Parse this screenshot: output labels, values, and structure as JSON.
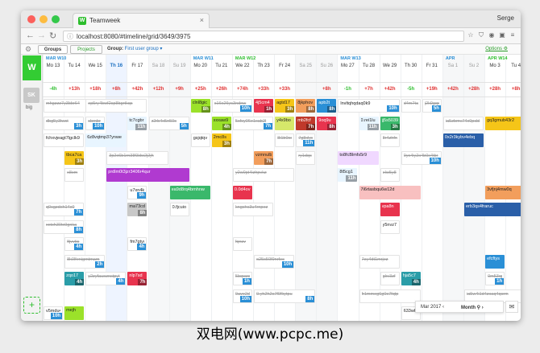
{
  "browser": {
    "tab_title": "Teamweek",
    "tab_close": "×",
    "user": "Serge",
    "url": "localhost:8080/#timeline/grid/3649/3975",
    "back": "←",
    "forward": "→",
    "reload": "↻",
    "star": "☆"
  },
  "toolbar": {
    "groups_tab": "Groups",
    "projects_tab": "Projects",
    "group_label": "Group:",
    "group_value": "First user group ▾",
    "options": "Options ⚙"
  },
  "sidebar": {
    "logo": "W",
    "avatar_initials": "SK",
    "avatar_name": "big",
    "add_user": "+"
  },
  "months": [
    {
      "label": "MAR W10",
      "green": false
    },
    {
      "label": "MAR W11",
      "green": false
    },
    {
      "label": "MAR W12",
      "green": true
    },
    {
      "label": "MAR W13",
      "green": false
    },
    {
      "label": "APR",
      "green": false
    },
    {
      "label": "APR W14",
      "green": true
    }
  ],
  "days": [
    {
      "label": "Mo 13",
      "weekend": false,
      "today": false
    },
    {
      "label": "Tu 14",
      "weekend": false,
      "today": false
    },
    {
      "label": "We 15",
      "weekend": false,
      "today": false
    },
    {
      "label": "Th 16",
      "weekend": false,
      "today": true
    },
    {
      "label": "Fr 17",
      "weekend": false,
      "today": false
    },
    {
      "label": "Sa 18",
      "weekend": true,
      "today": false
    },
    {
      "label": "Su 19",
      "weekend": true,
      "today": false
    },
    {
      "label": "Mo 20",
      "weekend": false,
      "today": false
    },
    {
      "label": "Tu 21",
      "weekend": false,
      "today": false
    },
    {
      "label": "We 22",
      "weekend": false,
      "today": false
    },
    {
      "label": "Th 23",
      "weekend": false,
      "today": false
    },
    {
      "label": "Fr 24",
      "weekend": false,
      "today": false
    },
    {
      "label": "Sa 25",
      "weekend": true,
      "today": false
    },
    {
      "label": "Su 26",
      "weekend": true,
      "today": false
    },
    {
      "label": "Mo 27",
      "weekend": false,
      "today": false
    },
    {
      "label": "Tu 28",
      "weekend": false,
      "today": false
    },
    {
      "label": "We 29",
      "weekend": false,
      "today": false
    },
    {
      "label": "Th 30",
      "weekend": false,
      "today": false
    },
    {
      "label": "Fr 31",
      "weekend": false,
      "today": false
    },
    {
      "label": "Sa 1",
      "weekend": true,
      "today": false
    },
    {
      "label": "Su 2",
      "weekend": true,
      "today": false
    },
    {
      "label": "Mo 3",
      "weekend": false,
      "today": false
    },
    {
      "label": "Tu 4",
      "weekend": false,
      "today": false
    }
  ],
  "hour_diffs": [
    "-4h",
    "+13h",
    "+18h",
    "+8h",
    "+42h",
    "+12h",
    "+9h",
    "+25h",
    "+26h",
    "+74h",
    "+33h",
    "+33h",
    "",
    "+8h",
    "-1h",
    "+7h",
    "+42h",
    "-5h",
    "+19h",
    "+42h",
    "+28h",
    "+28h",
    "+8h"
  ],
  "colors": {
    "positive": "#e03030",
    "negative": "#2dbe2d",
    "brand": "#33cc33",
    "link": "#1a6fc0"
  },
  "tasks": [
    {
      "label": "mhgzzz7y3bbr64",
      "hours": "",
      "color": "#ffffff",
      "done": true,
      "d": 0,
      "w": 2.6,
      "r": 0
    },
    {
      "label": "ep5ry4bwf2sp8bgrtkqs",
      "hours": "",
      "color": "#ffffff",
      "done": true,
      "d": 2,
      "w": 3,
      "r": 0
    },
    {
      "label": "clnl8gic",
      "hours": "8h",
      "color": "#9be12a",
      "done": false,
      "d": 7,
      "w": 1,
      "r": 0
    },
    {
      "label": "s16x26ys3ndnw",
      "hours": "10h",
      "color": "#ffffff",
      "done": true,
      "d": 8,
      "w": 2,
      "r": 0
    },
    {
      "label": "4j5cm4",
      "hours": "1h",
      "color": "#e8344e",
      "done": false,
      "d": 10,
      "w": 1,
      "r": 0
    },
    {
      "label": "agtd17",
      "hours": "3h",
      "color": "#f5c518",
      "done": false,
      "d": 11,
      "w": 1,
      "r": 0
    },
    {
      "label": "8jkphov",
      "hours": "8h",
      "color": "#f29e5c",
      "done": false,
      "d": 12,
      "w": 1,
      "r": 0
    },
    {
      "label": "apb2t",
      "hours": "8h",
      "color": "#2a8fd6",
      "done": false,
      "d": 13,
      "w": 1,
      "r": 0
    },
    {
      "label": "lnvltqhqdaq0k9",
      "hours": "10h",
      "color": "#ffffff",
      "done": false,
      "d": 14,
      "w": 3,
      "r": 0
    },
    {
      "label": "d4m7ta",
      "hours": "",
      "color": "#ffffff",
      "done": true,
      "d": 17,
      "w": 1,
      "r": 0
    },
    {
      "label": "j2k9gqs6",
      "hours": "5h",
      "color": "#ffffff",
      "done": true,
      "d": 18,
      "w": 1,
      "r": 0
    },
    {
      "label": "dbg5y3twst",
      "hours": "3h",
      "color": "#ffffff",
      "done": true,
      "d": 0,
      "w": 2,
      "r": 1
    },
    {
      "label": "sbrnbr",
      "hours": "10h",
      "color": "#ffffff",
      "done": true,
      "d": 2,
      "w": 1,
      "r": 1
    },
    {
      "label": "tc7cgbr",
      "hours": "11h",
      "color": "#e8f5ff",
      "done": false,
      "d": 4,
      "w": 1,
      "r": 1
    },
    {
      "label": "z2rb4x5n50s",
      "hours": "5h",
      "color": "#ffffff",
      "done": true,
      "d": 5,
      "w": 2,
      "r": 1
    },
    {
      "label": "xxxaw9",
      "hours": "4h",
      "color": "#9be12a",
      "done": false,
      "d": 8,
      "w": 1,
      "r": 1
    },
    {
      "label": "5sfsy06e1xab2l",
      "hours": "7h",
      "color": "#ffffff",
      "done": true,
      "d": 9,
      "w": 2,
      "r": 1
    },
    {
      "label": "y4x9bo",
      "hours": "",
      "color": "#d6e86a",
      "done": false,
      "d": 11,
      "w": 1,
      "r": 1
    },
    {
      "label": "mb2fcf",
      "hours": "7h",
      "color": "#c0392b",
      "done": false,
      "d": 12,
      "w": 1,
      "r": 1
    },
    {
      "label": "9oq9u",
      "hours": "8h",
      "color": "#e8344e",
      "done": false,
      "d": 13,
      "w": 1,
      "r": 1
    },
    {
      "label": "0.rei1lu",
      "hours": "11h",
      "color": "#e8f5ff",
      "done": false,
      "d": 15,
      "w": 1,
      "r": 1
    },
    {
      "label": "jj5s5039",
      "hours": "3h",
      "color": "#3ab86b",
      "done": false,
      "d": 16,
      "w": 1,
      "r": 1
    },
    {
      "label": "ia5zbmv74x0pcbl",
      "hours": "",
      "color": "#ffffff",
      "done": true,
      "d": 19,
      "w": 2,
      "r": 1
    },
    {
      "label": "gq3gmub43r2",
      "hours": "",
      "color": "#f5c518",
      "done": false,
      "d": 21,
      "w": 2,
      "r": 1
    },
    {
      "label": "fchxvjeagt7lgclk9",
      "hours": "",
      "color": "#ffffff",
      "done": false,
      "d": 0,
      "w": 2,
      "r": 2
    },
    {
      "label": "6z8vqtmp37ynwe",
      "hours": "",
      "color": "#e8f5ff",
      "done": false,
      "d": 2,
      "w": 2,
      "r": 2
    },
    {
      "label": "gsjqtqv",
      "hours": "",
      "color": "#ffffff",
      "done": false,
      "d": 7,
      "w": 1,
      "r": 2
    },
    {
      "label": "2mc8s",
      "hours": "3h",
      "color": "#f5c518",
      "done": false,
      "d": 8,
      "w": 1,
      "r": 2
    },
    {
      "label": "8i1b0sdg",
      "hours": "",
      "color": "#ffffff",
      "done": true,
      "d": 11,
      "w": 1,
      "r": 2
    },
    {
      "label": "7g8xlys",
      "hours": "11h",
      "color": "#ffffff",
      "done": true,
      "d": 12,
      "w": 1,
      "r": 2
    },
    {
      "label": "8r4zhfnm",
      "hours": "",
      "color": "#ffffff",
      "done": true,
      "d": 16,
      "w": 1,
      "r": 2
    },
    {
      "label": "0x2r3kybv4ebq",
      "hours": "",
      "color": "#2a5fa8",
      "done": false,
      "d": 19,
      "w": 2,
      "r": 2
    },
    {
      "label": "tbca7ca",
      "hours": "3h",
      "color": "#f5c518",
      "done": false,
      "d": 1,
      "w": 1,
      "r": 3
    },
    {
      "label": "3p2x6b1rn38f3dw2j2jh",
      "hours": "",
      "color": "#ffffff",
      "done": true,
      "d": 3,
      "w": 3,
      "r": 3
    },
    {
      "label": "vzmnulb",
      "hours": "7h",
      "color": "#f29e5c",
      "done": false,
      "d": 10,
      "w": 1,
      "r": 3
    },
    {
      "label": "ry1dqc",
      "hours": "",
      "color": "#ffffff",
      "done": true,
      "d": 12,
      "w": 1,
      "r": 3
    },
    {
      "label": "to8fcBlmfs5r9",
      "hours": "",
      "color": "#f0d8ff",
      "done": false,
      "d": 14,
      "w": 2,
      "r": 3
    },
    {
      "label": "0yx4iy2x4b0x4tbr",
      "hours": "10h",
      "color": "#ffffff",
      "done": true,
      "d": 17,
      "w": 2,
      "r": 3
    },
    {
      "label": "x8cm",
      "hours": "",
      "color": "#ffffff",
      "done": true,
      "d": 1,
      "w": 1,
      "r": 4
    },
    {
      "label": "prdlm0t3jzr3406r4qur",
      "hours": "",
      "color": "#b03ad0",
      "done": false,
      "d": 3,
      "w": 4,
      "r": 4
    },
    {
      "label": "y2w0pt4izhpvkz",
      "hours": "",
      "color": "#ffffff",
      "done": true,
      "d": 9,
      "w": 3,
      "r": 4
    },
    {
      "label": "8t5cg1",
      "hours": "11h",
      "color": "#e8f5ff",
      "done": false,
      "d": 14,
      "w": 1,
      "r": 4
    },
    {
      "label": "elw5y8",
      "hours": "",
      "color": "#ffffff",
      "done": true,
      "d": 16,
      "w": 1,
      "r": 4
    },
    {
      "label": "u7xn4k",
      "hours": "9h",
      "color": "#ffffff",
      "done": false,
      "d": 4,
      "w": 1,
      "r": 5
    },
    {
      "label": "ea9d8rq4brnhnw",
      "hours": "",
      "color": "#3ab86b",
      "done": false,
      "d": 6,
      "w": 2,
      "r": 5
    },
    {
      "label": "0.0d4ov",
      "hours": "",
      "color": "#e8344e",
      "done": false,
      "d": 9,
      "w": 1,
      "r": 5
    },
    {
      "label": "7i6rtasbqu6w12d",
      "hours": "",
      "color": "#f8c0c0",
      "done": false,
      "d": 15,
      "w": 3,
      "r": 5
    },
    {
      "label": "3vfjnj4mw0q",
      "hours": "",
      "color": "#f29e5c",
      "done": false,
      "d": 21,
      "w": 2,
      "r": 5
    },
    {
      "label": "q0sgzdxh14c0",
      "hours": "7h",
      "color": "#ffffff",
      "done": true,
      "d": 0,
      "w": 2,
      "r": 6
    },
    {
      "label": "ma73cd",
      "hours": "8h",
      "color": "#c8c8c8",
      "done": false,
      "d": 4,
      "w": 1,
      "r": 6
    },
    {
      "label": "0.fjcuio",
      "hours": "",
      "color": "#ffffff",
      "done": false,
      "d": 6,
      "w": 1,
      "r": 6
    },
    {
      "label": "kngchc3u4rnpez",
      "hours": "",
      "color": "#ffffff",
      "done": true,
      "d": 9,
      "w": 2,
      "r": 6
    },
    {
      "label": "vpa8n",
      "hours": "",
      "color": "#e8344e",
      "done": false,
      "d": 16,
      "w": 1,
      "r": 6
    },
    {
      "label": "erb3qs4fraruc",
      "hours": "",
      "color": "#2a5fa8",
      "done": false,
      "d": 20,
      "w": 3,
      "r": 6
    },
    {
      "label": "xxtch30tx9gnka",
      "hours": "8h",
      "color": "#ffffff",
      "done": true,
      "d": 0,
      "w": 2,
      "r": 7
    },
    {
      "label": "y5nvz7",
      "hours": "",
      "color": "#ffffff",
      "done": false,
      "d": 16,
      "w": 1,
      "r": 7
    },
    {
      "label": "ftjvvtic",
      "hours": "4h",
      "color": "#ffffff",
      "done": true,
      "d": 1,
      "w": 1,
      "r": 8
    },
    {
      "label": "fm7gtyc",
      "hours": "4h",
      "color": "#ffffff",
      "done": false,
      "d": 4,
      "w": 1,
      "r": 8
    },
    {
      "label": "fqnsv",
      "hours": "",
      "color": "#ffffff",
      "done": true,
      "d": 9,
      "w": 1,
      "r": 8
    },
    {
      "label": "8k0lfenigmtmam",
      "hours": "2h",
      "color": "#ffffff",
      "done": true,
      "d": 1,
      "w": 2,
      "r": 9
    },
    {
      "label": "o25s50f9nrfec",
      "hours": "10h",
      "color": "#ffffff",
      "done": true,
      "d": 10,
      "w": 2,
      "r": 9
    },
    {
      "label": "7ey4dt1mrjez",
      "hours": "",
      "color": "#ffffff",
      "done": true,
      "d": 15,
      "w": 2,
      "r": 9
    },
    {
      "label": "efcftys",
      "hours": "",
      "color": "#2a8fd6",
      "done": false,
      "d": 21,
      "w": 1,
      "r": 9
    },
    {
      "label": "zqo17",
      "hours": "4h",
      "color": "#2a9da8",
      "done": false,
      "d": 1,
      "w": 1,
      "r": 10
    },
    {
      "label": "y2zyfauoznstpyt",
      "hours": "4h",
      "color": "#ffffff",
      "done": true,
      "d": 2,
      "w": 2,
      "r": 10
    },
    {
      "label": "nlp7sd",
      "hours": "7h",
      "color": "#e8344e",
      "done": false,
      "d": 4,
      "w": 1,
      "r": 10
    },
    {
      "label": "5bqwzs",
      "hours": "1h",
      "color": "#ffffff",
      "done": true,
      "d": 9,
      "w": 1,
      "r": 10
    },
    {
      "label": "gkv3zf",
      "hours": "",
      "color": "#ffffff",
      "done": true,
      "d": 16,
      "w": 1,
      "r": 10
    },
    {
      "label": "hja5c7",
      "hours": "4h",
      "color": "#2a9da8",
      "done": false,
      "d": 17,
      "w": 1,
      "r": 10
    },
    {
      "label": "0m53qp5q",
      "hours": "1h",
      "color": "#ffffff",
      "done": true,
      "d": 21,
      "w": 1,
      "r": 10
    },
    {
      "label": "0ave2d",
      "hours": "10h",
      "color": "#ffffff",
      "done": true,
      "d": 9,
      "w": 1,
      "r": 11
    },
    {
      "label": "0.yh2h2s7f9fkytpu",
      "hours": "8h",
      "color": "#ffffff",
      "done": true,
      "d": 10,
      "w": 3,
      "r": 11
    },
    {
      "label": "fr1mmeg6g0c7fqtp",
      "hours": "",
      "color": "#ffffff",
      "done": true,
      "d": 15,
      "w": 3,
      "r": 11
    },
    {
      "label": "ia5w4i1d4zxaq4qcrm",
      "hours": "",
      "color": "#ffffff",
      "done": true,
      "d": 20,
      "w": 3,
      "r": 11
    },
    {
      "label": "v5mdu4",
      "hours": "10h",
      "color": "#ffffff",
      "done": false,
      "d": 0,
      "w": 1,
      "r": 12
    },
    {
      "label": "mejh",
      "hours": "",
      "color": "#9be12a",
      "done": false,
      "d": 1,
      "w": 1,
      "r": 12
    },
    {
      "label": "633wh4",
      "hours": "",
      "color": "#ffffff",
      "done": false,
      "d": 17,
      "w": 1,
      "r": 12
    },
    {
      "label": "bcts16xfnb3er",
      "hours": "",
      "color": "#f5c518",
      "done": false,
      "d": 7,
      "w": 3,
      "r": 13
    }
  ],
  "date_control": {
    "month": "Mar 2017 ‹",
    "mode": "Month ⚲ ›",
    "inbox": "✉"
  },
  "watermark": "双电网(www.pcpc.me)"
}
